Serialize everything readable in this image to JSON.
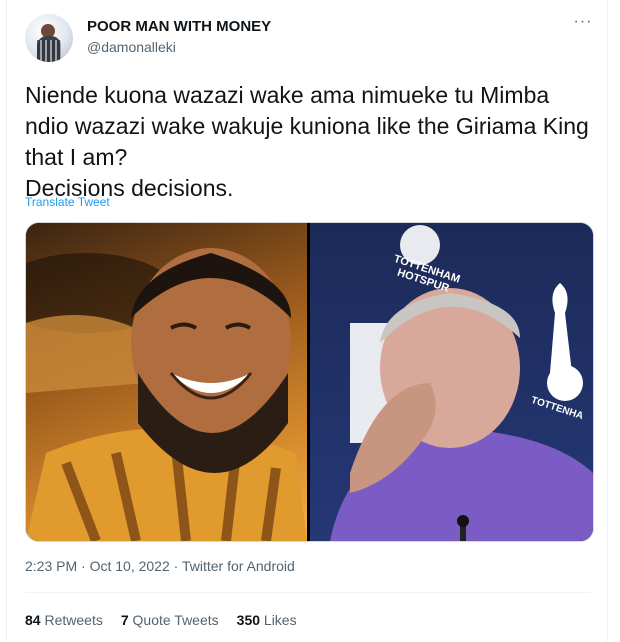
{
  "author": {
    "display_name": "POOR MAN WITH MONEY",
    "handle": "@damonalleki"
  },
  "tweet": {
    "text": "Niende kuona wazazi wake ama nimueke tu Mimba\nndio wazazi wake wakuje kuniona like the Giriama King\nthat I am?\nDecisions decisions.",
    "translate_label": "Translate Tweet",
    "more_label": "···"
  },
  "media": {
    "plaque_text": "TOTTENHAM\nHOTSPUR",
    "plaque_text_2": "TOTTENHA"
  },
  "meta": {
    "time": "2:23 PM",
    "date": "Oct 10, 2022",
    "source": "Twitter for Android",
    "separator": " · "
  },
  "stats": [
    {
      "count": "84",
      "label": "Retweets"
    },
    {
      "count": "7",
      "label": "Quote Tweets"
    },
    {
      "count": "350",
      "label": "Likes"
    }
  ]
}
